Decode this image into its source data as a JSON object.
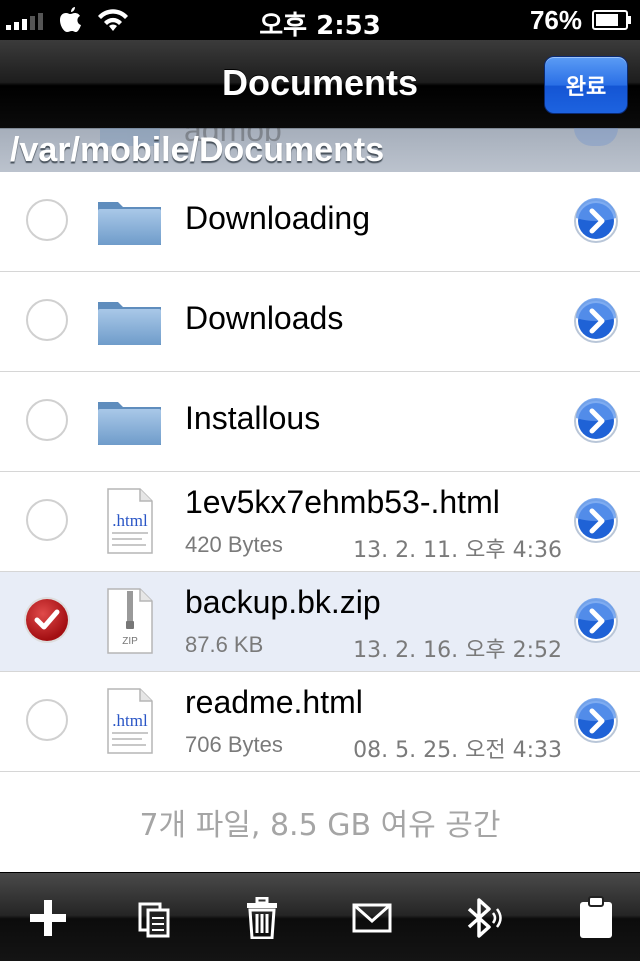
{
  "status_bar": {
    "time": "오후 2:53",
    "battery": "76%"
  },
  "nav": {
    "title": "Documents",
    "done_label": "완료"
  },
  "path_header": {
    "path": "/var/mobile/Documents",
    "scrolled_item": "admob"
  },
  "items": [
    {
      "name": "Downloading",
      "type": "folder",
      "selected": false
    },
    {
      "name": "Downloads",
      "type": "folder",
      "selected": false
    },
    {
      "name": "Installous",
      "type": "folder",
      "selected": false
    },
    {
      "name": "1ev5kx7ehmb53-.html",
      "type": "html",
      "size": "420 Bytes",
      "date": "13. 2. 11. 오후 4:36",
      "selected": false
    },
    {
      "name": "backup.bk.zip",
      "type": "zip",
      "size": "87.6 KB",
      "date": "13. 2. 16. 오후 2:52",
      "selected": true
    },
    {
      "name": "readme.html",
      "type": "html",
      "size": "706 Bytes",
      "date": "08. 5. 25. 오전 4:33",
      "selected": false
    }
  ],
  "footer": {
    "summary": "7개 파일, 8.5 GB 여유 공간"
  },
  "icon_labels": {
    "html": ".html",
    "zip": "ZIP"
  },
  "toolbar": {
    "buttons": [
      "add-icon",
      "copy-file-icon",
      "trash-icon",
      "mail-icon",
      "bluetooth-icon",
      "clipboard-icon"
    ]
  },
  "colors": {
    "accent_blue": "#1d63e0",
    "checked_red": "#b81a1d",
    "folder_blue": "#7aa6d3"
  }
}
